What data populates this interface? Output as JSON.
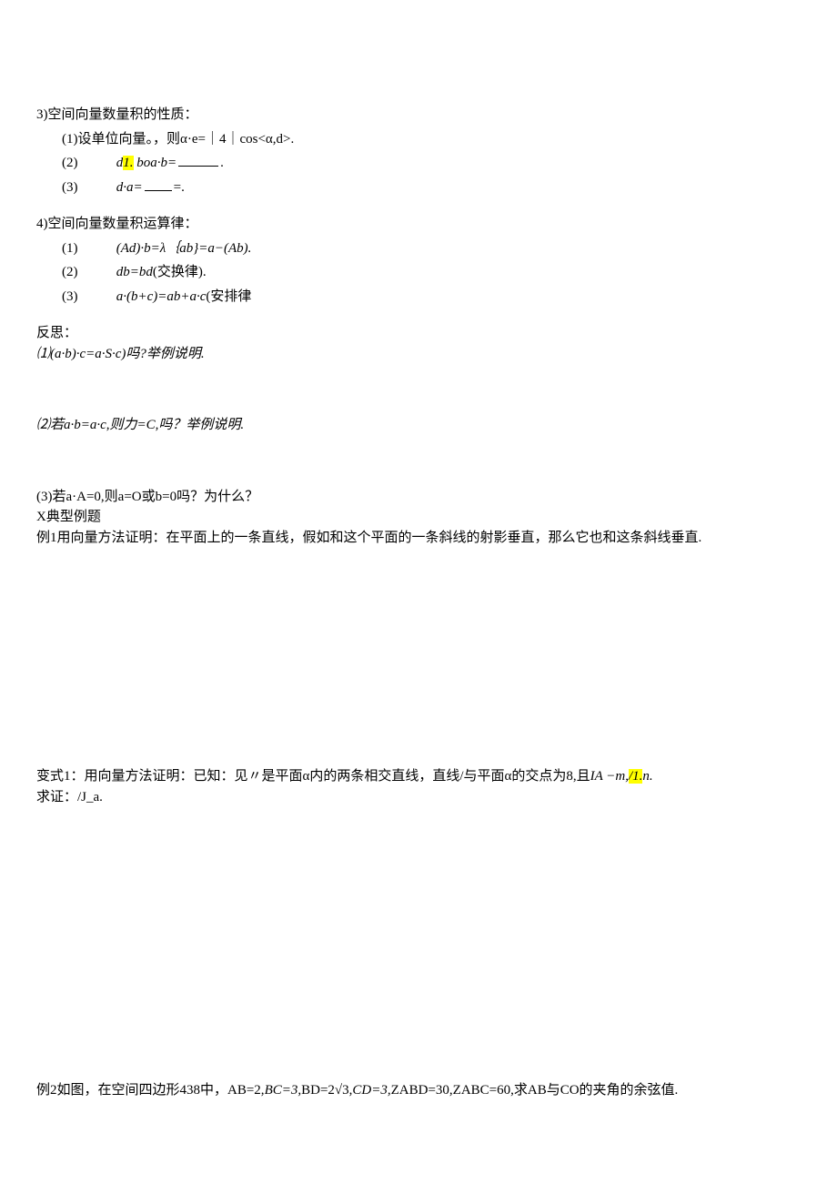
{
  "section3": {
    "heading": "3)空间向量数量积的性质：",
    "item1": "(1)设单位向量。，则α·e=｜4｜cos<α,d>.",
    "item2_num": "(2)",
    "item2_d": "d",
    "item2_hl": "1.",
    "item2_rest": " boa·b=",
    "item2_end": ".",
    "item3_num": "(3)",
    "item3_text": "d·a=",
    "item3_end": "=."
  },
  "section4": {
    "heading": "4)空间向量数量积运算律：",
    "item1_num": "(1)",
    "item1_text": "(Ad)·b=λ｛ab}=a−(Ab).",
    "item2_num": "(2)",
    "item2_text": "db=bd",
    "item2_paren": "(交换律).",
    "item3_num": "(3)",
    "item3_text": "a·(b+c)=ab+a·c",
    "item3_paren": "(安排律"
  },
  "reflect": {
    "heading": "反思：",
    "q1": "⑴(a·b)·c=a·S·c)吗?举例说明.",
    "q2": "⑵若a·b=a·c,则力=C,吗？举例说明.",
    "q3": "(3)若a·A=0,则a=O或b=0吗？为什么？"
  },
  "examples": {
    "heading": "X典型例题",
    "ex1": "例1用向量方法证明：在平面上的一条直线，假如和这个平面的一条斜线的射影垂直，那么它也和这条斜线垂直.",
    "var1_pre": "变式1：用向量方法证明：已知：见〃是平面α内的两条相交直线，直线/与平面α的交点为8,且",
    "var1_ital": "IA −m,",
    "var1_hl": "/1.",
    "var1_ital2": "n.",
    "var1_qz": "求证：/J_a.",
    "ex2_pre": "例2如图，在空间四边形438中，AB=2,",
    "ex2_bc": "BC=3,",
    "ex2_bd": "BD=2√3,",
    "ex2_cd": "CD=3,",
    "ex2_rest": "ZABD=30,ZABC=60,求AB与CO的夹角的余弦值."
  }
}
